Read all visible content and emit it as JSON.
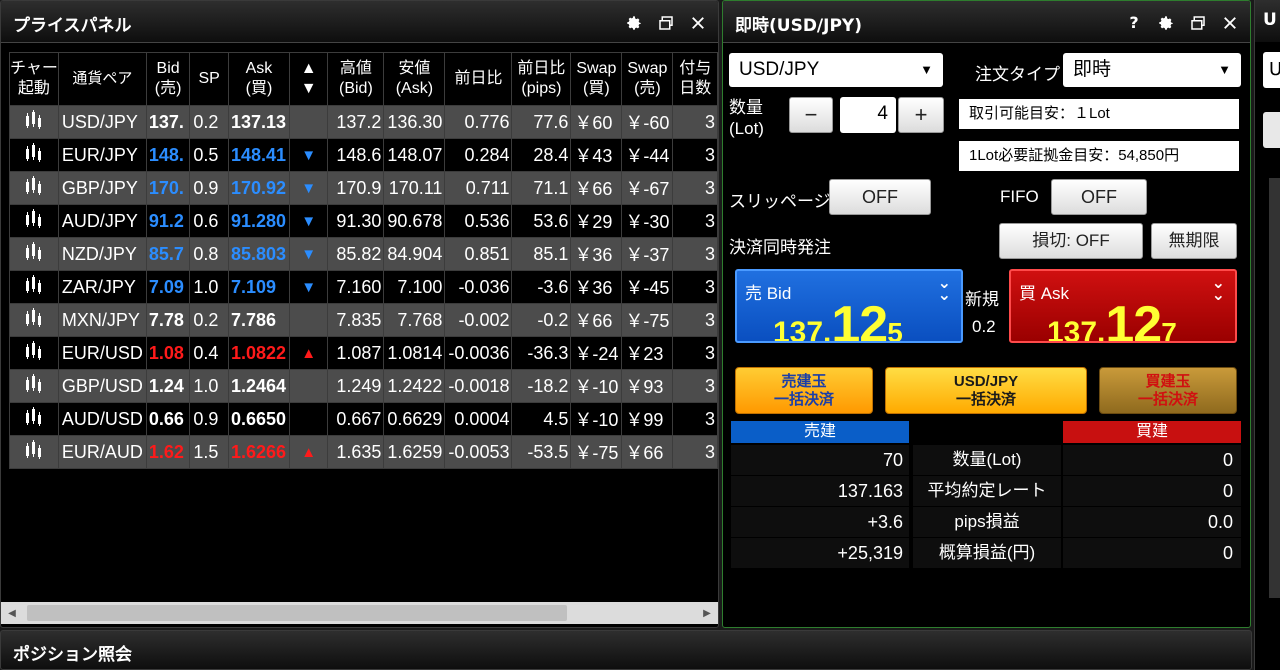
{
  "price_panel": {
    "title": "プライスパネル",
    "columns": [
      "チャート起動",
      "通貨ペア",
      "Bid(売)",
      "SP",
      "Ask(買)",
      "▲▼",
      "高値(Bid)",
      "安値(Ask)",
      "前日比",
      "前日比(pips)",
      "Swap(買)",
      "Swap(売)",
      "付与日数"
    ],
    "column_lines": [
      [
        "チャー",
        "起動"
      ],
      [
        "通貨ペア"
      ],
      [
        "Bid",
        "(売)"
      ],
      [
        "SP"
      ],
      [
        "Ask",
        "(買)"
      ],
      [
        "▲",
        "▼"
      ],
      [
        "高値",
        "(Bid)"
      ],
      [
        "安値",
        "(Ask)"
      ],
      [
        "前日比"
      ],
      [
        "前日比",
        "(pips)"
      ],
      [
        "Swap",
        "(買)"
      ],
      [
        "Swap",
        "(売)"
      ],
      [
        "付与",
        "日数"
      ]
    ],
    "rows": [
      {
        "pair": "USD/JPY",
        "bid": "137.",
        "sp": "0.2",
        "ask": "137.13",
        "arrow": "",
        "high": "137.2",
        "low": "136.30",
        "change": "0.776",
        "change_pips": "77.6",
        "swap_buy": "￥60",
        "swap_sell": "￥-60",
        "days": "3",
        "color": "white",
        "shade": "light"
      },
      {
        "pair": "EUR/JPY",
        "bid": "148.",
        "sp": "0.5",
        "ask": "148.41",
        "arrow": "▼",
        "high": "148.6",
        "low": "148.07",
        "change": "0.284",
        "change_pips": "28.4",
        "swap_buy": "￥43",
        "swap_sell": "￥-44",
        "days": "3",
        "color": "blue",
        "shade": "dark"
      },
      {
        "pair": "GBP/JPY",
        "bid": "170.",
        "sp": "0.9",
        "ask": "170.92",
        "arrow": "▼",
        "high": "170.9",
        "low": "170.11",
        "change": "0.711",
        "change_pips": "71.1",
        "swap_buy": "￥66",
        "swap_sell": "￥-67",
        "days": "3",
        "color": "blue",
        "shade": "light"
      },
      {
        "pair": "AUD/JPY",
        "bid": "91.2",
        "sp": "0.6",
        "ask": "91.280",
        "arrow": "▼",
        "high": "91.30",
        "low": "90.678",
        "change": "0.536",
        "change_pips": "53.6",
        "swap_buy": "￥29",
        "swap_sell": "￥-30",
        "days": "3",
        "color": "blue",
        "shade": "dark"
      },
      {
        "pair": "NZD/JPY",
        "bid": "85.7",
        "sp": "0.8",
        "ask": "85.803",
        "arrow": "▼",
        "high": "85.82",
        "low": "84.904",
        "change": "0.851",
        "change_pips": "85.1",
        "swap_buy": "￥36",
        "swap_sell": "￥-37",
        "days": "3",
        "color": "blue",
        "shade": "light"
      },
      {
        "pair": "ZAR/JPY",
        "bid": "7.09",
        "sp": "1.0",
        "ask": "7.109",
        "arrow": "▼",
        "high": "7.160",
        "low": "7.100",
        "change": "-0.036",
        "change_pips": "-3.6",
        "swap_buy": "￥36",
        "swap_sell": "￥-45",
        "days": "3",
        "color": "blue",
        "shade": "dark"
      },
      {
        "pair": "MXN/JPY",
        "bid": "7.78",
        "sp": "0.2",
        "ask": "7.786",
        "arrow": "",
        "high": "7.835",
        "low": "7.768",
        "change": "-0.002",
        "change_pips": "-0.2",
        "swap_buy": "￥66",
        "swap_sell": "￥-75",
        "days": "3",
        "color": "white",
        "shade": "light"
      },
      {
        "pair": "EUR/USD",
        "bid": "1.08",
        "sp": "0.4",
        "ask": "1.0822",
        "arrow": "▲",
        "high": "1.087",
        "low": "1.0814",
        "change": "-0.0036",
        "change_pips": "-36.3",
        "swap_buy": "￥-24",
        "swap_sell": "￥23",
        "days": "3",
        "color": "red",
        "shade": "dark"
      },
      {
        "pair": "GBP/USD",
        "bid": "1.24",
        "sp": "1.0",
        "ask": "1.2464",
        "arrow": "",
        "high": "1.249",
        "low": "1.2422",
        "change": "-0.0018",
        "change_pips": "-18.2",
        "swap_buy": "￥-10",
        "swap_sell": "￥93",
        "days": "3",
        "color": "white",
        "shade": "light"
      },
      {
        "pair": "AUD/USD",
        "bid": "0.66",
        "sp": "0.9",
        "ask": "0.6650",
        "arrow": "",
        "high": "0.667",
        "low": "0.6629",
        "change": "0.0004",
        "change_pips": "4.5",
        "swap_buy": "￥-10",
        "swap_sell": "￥99",
        "days": "3",
        "color": "white",
        "shade": "dark"
      },
      {
        "pair": "EUR/AUD",
        "bid": "1.62",
        "sp": "1.5",
        "ask": "1.6266",
        "arrow": "▲",
        "high": "1.635",
        "low": "1.6259",
        "change": "-0.0053",
        "change_pips": "-53.5",
        "swap_buy": "￥-75",
        "swap_sell": "￥66",
        "days": "3",
        "color": "red",
        "shade": "light"
      }
    ]
  },
  "order_panel": {
    "title": "即時(USD/JPY)",
    "pair_select": "USD/JPY",
    "order_type_label": "注文タイプ",
    "order_type_value": "即時",
    "qty_label_1": "数量",
    "qty_label_2": "(Lot)",
    "qty_minus": "−",
    "qty_value": "4",
    "qty_plus": "+",
    "tradable_info": "取引可能目安：１Lot",
    "margin_info": "1Lot必要証拠金目安：54,850円",
    "slippage_label": "スリッページ",
    "slippage_value": "OFF",
    "fifo_label": "FIFO",
    "fifo_value": "OFF",
    "settle_label": "決済同時発注",
    "stoploss_button": "損切: OFF",
    "unlimited_button": "無期限",
    "bid": {
      "label": "売 Bid",
      "p1": "137.",
      "p2": "12",
      "p3": "5"
    },
    "ask": {
      "label": "買 Ask",
      "p1": "137.",
      "p2": "12",
      "p3": "7"
    },
    "new_label": "新規",
    "spread": "0.2",
    "bulk_sell": [
      "売建玉",
      "一括決済"
    ],
    "bulk_pair": [
      "USD/JPY",
      "一括決済"
    ],
    "bulk_buy": [
      "買建玉",
      "一括決済"
    ],
    "sell_header": "売建",
    "buy_header": "買建",
    "stats": [
      {
        "label": "数量(Lot)",
        "sell": "70",
        "buy": "0"
      },
      {
        "label": "平均約定レート",
        "sell": "137.163",
        "buy": "0"
      },
      {
        "label": "pips損益",
        "sell": "+3.6",
        "buy": "0.0"
      },
      {
        "label": "概算損益(円)",
        "sell": "+25,319",
        "buy": "0"
      }
    ]
  },
  "position_panel": {
    "title": "ポジション照会"
  },
  "right_panel": {
    "title": "U",
    "box_text": "U"
  },
  "colors": {
    "bid_blue": "#2b8dff",
    "ask_red": "#ff1a1a",
    "sell_header": "#0a5ec8",
    "buy_header": "#c81010",
    "accent_yellow": "#ffff33"
  }
}
